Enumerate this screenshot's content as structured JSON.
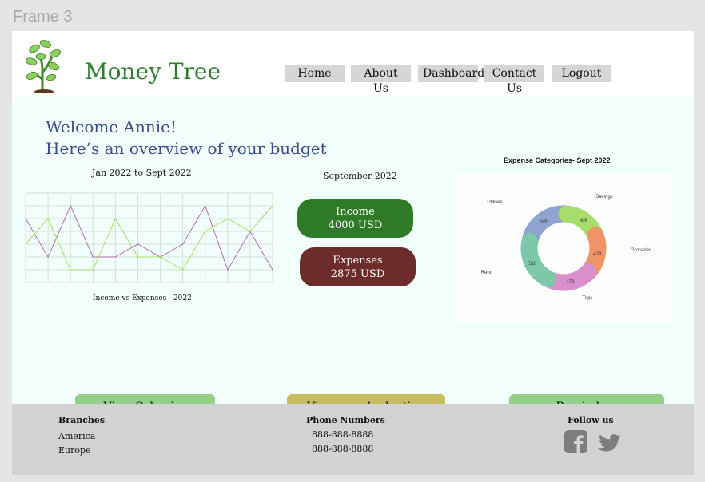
{
  "canvas": {
    "frame_label": "Frame 3"
  },
  "header": {
    "brand": "Money Tree",
    "nav": [
      {
        "label": "Home"
      },
      {
        "label": "About Us"
      },
      {
        "label": "Dashboard"
      },
      {
        "label": "Contact Us"
      },
      {
        "label": "Logout"
      }
    ]
  },
  "main": {
    "welcome_line1": "Welcome Annie!",
    "welcome_line2": "Here’s an overview of your budget",
    "line_chart": {
      "title": "Jan 2022 to Sept 2022",
      "caption": "Income vs Expenses - 2022"
    },
    "summary": {
      "title": "September 2022",
      "income_label": "Income",
      "income_value": "4000 USD",
      "expenses_label": "Expenses",
      "expenses_value": "2875 USD"
    },
    "donut": {
      "title": "Expense Categories- Sept 2022"
    },
    "buttons": {
      "calendar": "View Calendar",
      "report": "View your budgeting report",
      "reminders": "Reminders"
    },
    "colors": {
      "income": "#2e7a27",
      "expenses": "#6b2c2a",
      "calendar_btn": "#94cf8c",
      "report_btn": "#c4bd5e",
      "reminders_btn": "#94cf8c"
    }
  },
  "footer": {
    "branches_title": "Branches",
    "branches": [
      "America",
      "Europe"
    ],
    "phones_title": "Phone Numbers",
    "phones": [
      "888-888-8888",
      "888-888-8888"
    ],
    "social_title": "Follow us",
    "social_icons": [
      "facebook-icon",
      "twitter-icon"
    ]
  },
  "chart_data": [
    {
      "type": "line",
      "title": "Jan 2022 to Sept 2022",
      "xlabel": "Income vs Expenses - 2022",
      "x": [
        1,
        2,
        3,
        4,
        5,
        6,
        7,
        8,
        9,
        10,
        11,
        12
      ],
      "series": [
        {
          "values": [
            5,
            2,
            6,
            2,
            2,
            3,
            2,
            3,
            6,
            1,
            4,
            1
          ],
          "color": "#b06bb0"
        },
        {
          "values": [
            3,
            5,
            1,
            1,
            5,
            2,
            2,
            1,
            4,
            5,
            4,
            6
          ],
          "color": "#a6dd5a"
        }
      ],
      "ylim": [
        0,
        7
      ],
      "grid": true
    },
    {
      "type": "pie",
      "title": "Expense Categories- Sept 2022",
      "categories": [
        "Utilities",
        "Savings",
        "Groceries",
        "Trips",
        "Rent"
      ],
      "values": [
        528,
        408,
        429,
        472,
        510
      ],
      "colors": [
        "#8fa3cf",
        "#a6dd6b",
        "#ee9466",
        "#d88fcb",
        "#7cc8a8"
      ]
    }
  ]
}
